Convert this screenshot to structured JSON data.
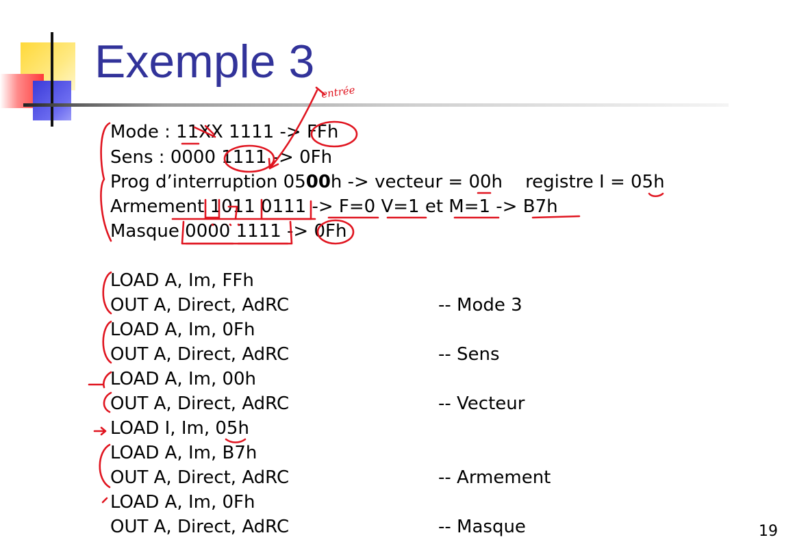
{
  "slide": {
    "title": "Exemple 3",
    "page_number": "19",
    "accent_color": "#32339a",
    "annotation_color": "#e0141f"
  },
  "config_lines": [
    {
      "label": "Mode",
      "text_a": "Mode : 11XX 1111 -> FFh",
      "bold": "",
      "text_b": ""
    },
    {
      "label": "Sens",
      "text_a": "Sens : 0000 1111 -> 0Fh",
      "bold": "",
      "text_b": ""
    },
    {
      "label": "Prog",
      "text_a": "Prog d’interruption 05",
      "bold": "00",
      "text_b": "h -> vecteur = 00h    registre I = 05h"
    },
    {
      "label": "Armement",
      "text_a": "Armement 1011 0111 -> F=0 V=1 et M=1 -> B7h",
      "bold": "",
      "text_b": ""
    },
    {
      "label": "Masque",
      "text_a": "Masque 0000 1111 -> 0Fh",
      "bold": "",
      "text_b": ""
    }
  ],
  "code_lines": [
    {
      "instr": "LOAD A, Im, FFh",
      "comment": ""
    },
    {
      "instr": "OUT A, Direct, AdRC",
      "comment": "-- Mode 3"
    },
    {
      "instr": "LOAD A, Im, 0Fh",
      "comment": ""
    },
    {
      "instr": "OUT A, Direct, AdRC",
      "comment": "-- Sens"
    },
    {
      "instr": "LOAD A, Im, 00h",
      "comment": ""
    },
    {
      "instr": "OUT A, Direct, AdRC",
      "comment": "-- Vecteur"
    },
    {
      "instr": "LOAD I, Im, 05h",
      "comment": ""
    },
    {
      "instr": "LOAD A, Im, B7h",
      "comment": ""
    },
    {
      "instr": "OUT A, Direct, AdRC",
      "comment": "-- Armement"
    },
    {
      "instr": "LOAD A, Im, 0Fh",
      "comment": ""
    },
    {
      "instr": "OUT A, Direct, AdRC",
      "comment": "-- Masque"
    }
  ],
  "handwriting": {
    "note": "entrée"
  }
}
